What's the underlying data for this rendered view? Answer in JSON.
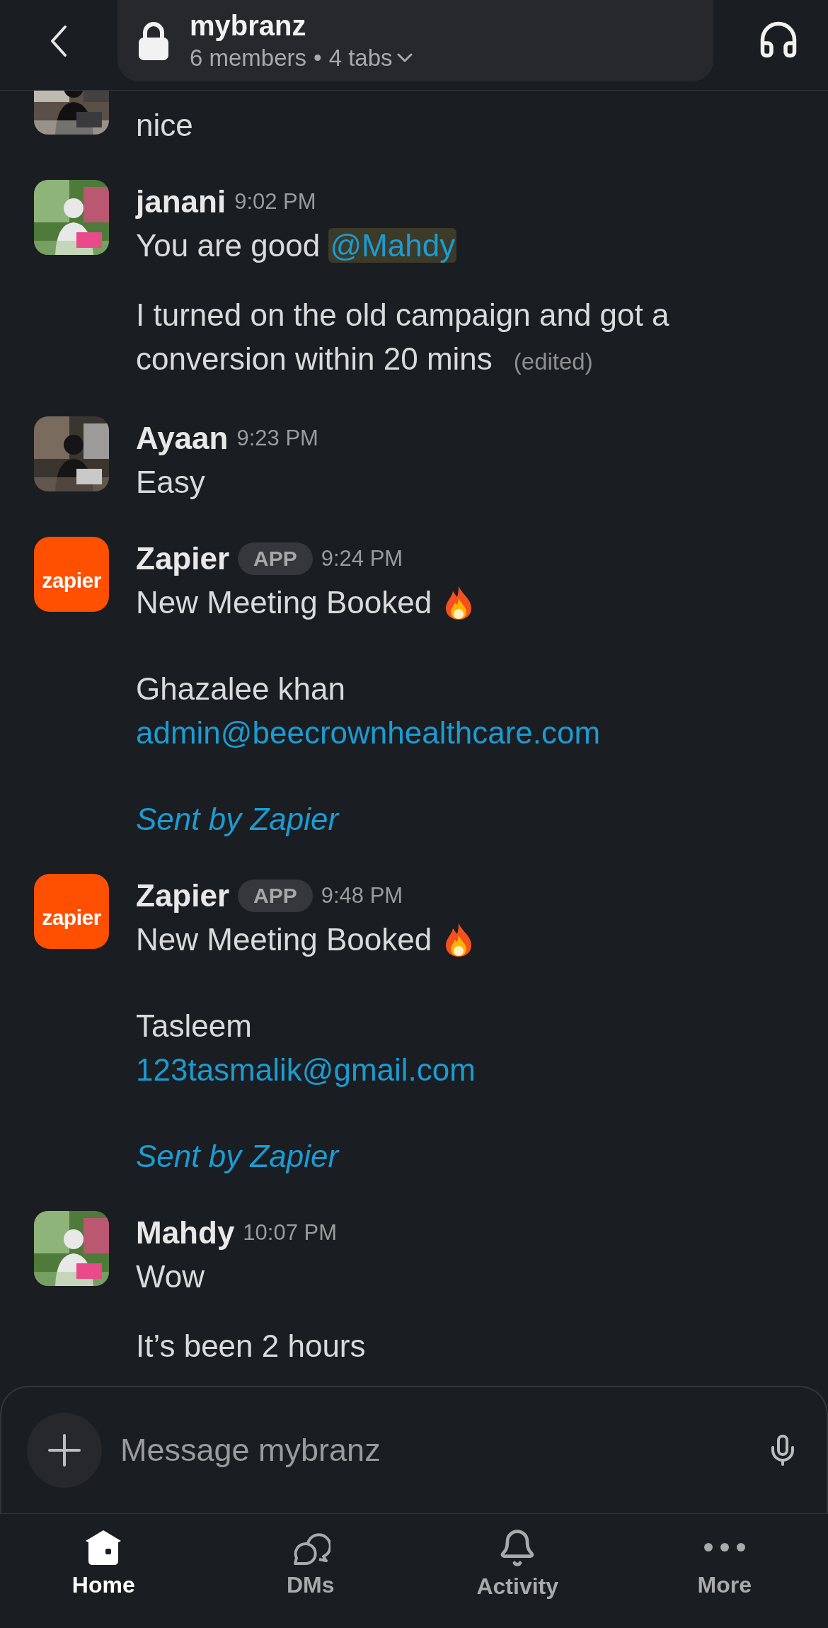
{
  "header": {
    "title": "mybranz",
    "members": "6 members",
    "separator": "•",
    "tabs": "4 tabs"
  },
  "messages": [
    {
      "kind": "user",
      "posts": [
        [
          {
            "kind": "text",
            "text": "nice"
          }
        ]
      ]
    },
    {
      "kind": "user",
      "author": "janani",
      "time": "9:02 PM",
      "posts": [
        [
          {
            "kind": "text",
            "text": "You are good "
          },
          {
            "kind": "mention",
            "text": "@Mahdy"
          }
        ],
        [
          {
            "kind": "text",
            "text": "I turned on the old campaign and got a conversion within 20 mins"
          },
          {
            "kind": "edited",
            "text": "(edited)"
          }
        ]
      ]
    },
    {
      "kind": "user",
      "author": "Ayaan",
      "time": "9:23 PM",
      "posts": [
        [
          {
            "kind": "text",
            "text": "Easy"
          }
        ]
      ]
    },
    {
      "kind": "app",
      "author": "Zapier",
      "badge": "APP",
      "time": "9:24 PM",
      "logo": "zapier",
      "paragraphs": [
        [
          {
            "kind": "headline",
            "text": "New Meeting Booked"
          }
        ],
        [
          {
            "kind": "text",
            "text": "Ghazalee khan"
          },
          {
            "kind": "link",
            "text": "admin@beecrownhealthcare.com"
          }
        ],
        [
          {
            "kind": "footer",
            "text": "Sent by Zapier"
          }
        ]
      ]
    },
    {
      "kind": "app",
      "author": "Zapier",
      "badge": "APP",
      "time": "9:48 PM",
      "logo": "zapier",
      "paragraphs": [
        [
          {
            "kind": "headline",
            "text": "New Meeting Booked"
          }
        ],
        [
          {
            "kind": "text",
            "text": "Tasleem"
          },
          {
            "kind": "link",
            "text": "123tasmalik@gmail.com"
          }
        ],
        [
          {
            "kind": "footer",
            "text": "Sent by Zapier"
          }
        ]
      ]
    },
    {
      "kind": "user",
      "author": "Mahdy",
      "time": "10:07 PM",
      "posts": [
        [
          {
            "kind": "text",
            "text": "Wow"
          }
        ],
        [
          {
            "kind": "text",
            "text": "It’s been 2 hours"
          }
        ]
      ]
    }
  ],
  "composer": {
    "placeholder": "Message mybranz"
  },
  "nav": [
    {
      "kind": "home",
      "label": "Home",
      "selected": true
    },
    {
      "kind": "dms",
      "label": "DMs",
      "selected": false
    },
    {
      "kind": "activity",
      "label": "Activity",
      "selected": false
    },
    {
      "kind": "more",
      "label": "More",
      "selected": false
    }
  ]
}
